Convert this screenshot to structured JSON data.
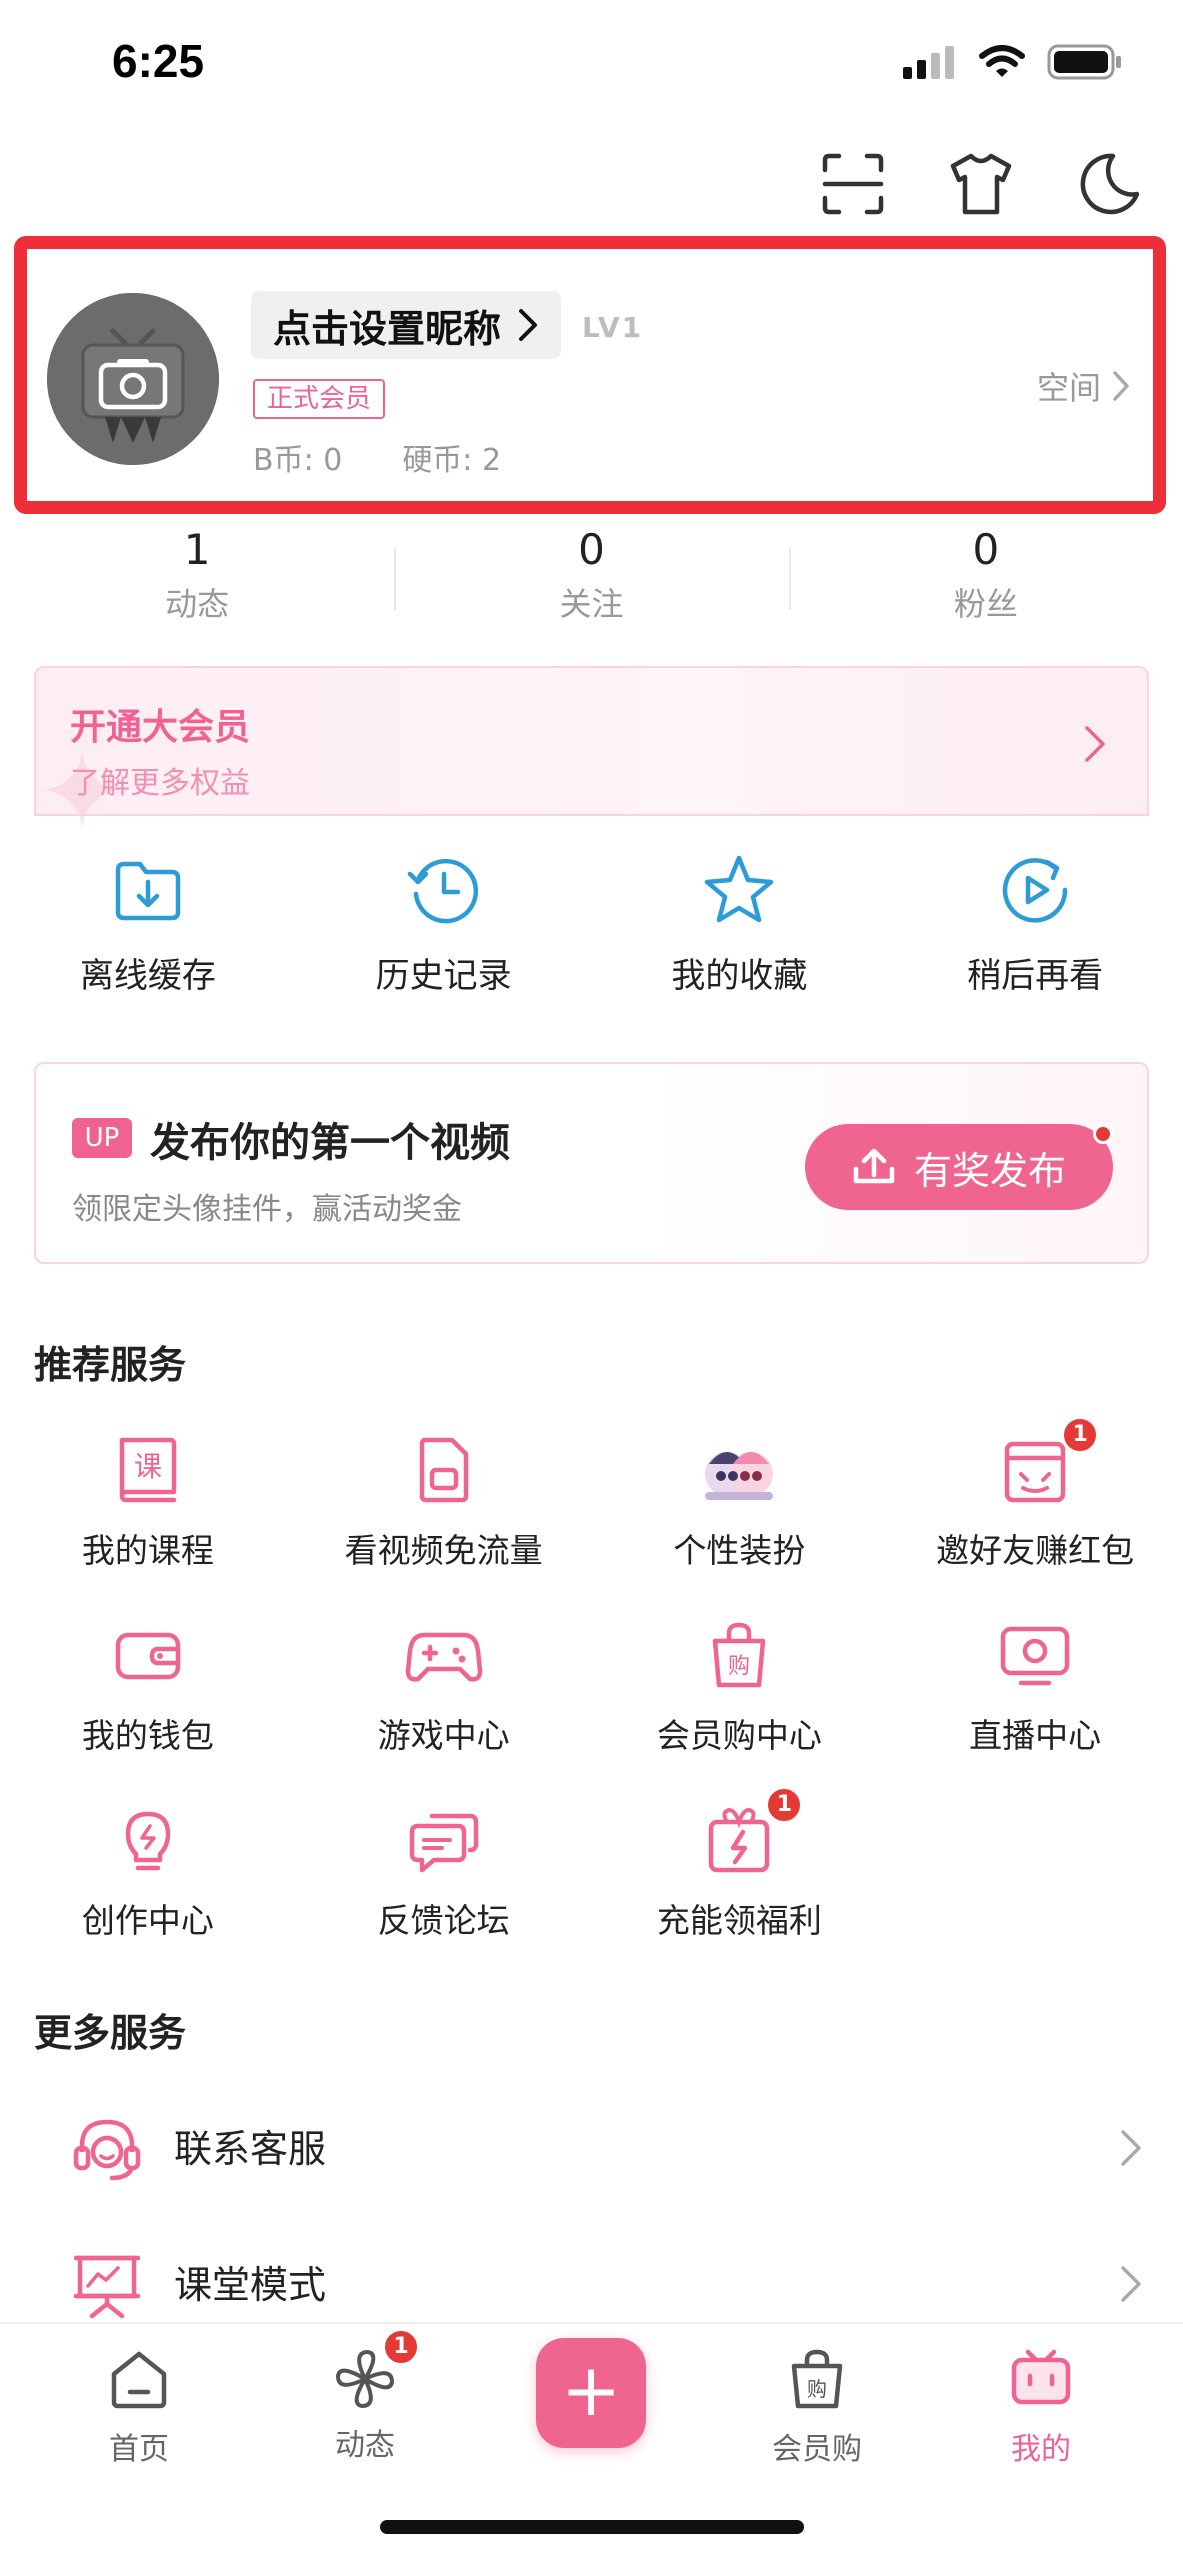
{
  "status_bar": {
    "time": "6:25"
  },
  "profile": {
    "nickname": "点击设置昵称",
    "level": "LV1",
    "vip_tag": "正式会员",
    "b_coins": "B币: 0",
    "coins": "硬币: 2",
    "space_label": "空间"
  },
  "stats": [
    {
      "value": "1",
      "label": "动态"
    },
    {
      "value": "0",
      "label": "关注"
    },
    {
      "value": "0",
      "label": "粉丝"
    }
  ],
  "vip_banner": {
    "title": "开通大会员",
    "subtitle": "了解更多权益"
  },
  "quick_actions": [
    {
      "label": "离线缓存",
      "icon": "download-folder-icon"
    },
    {
      "label": "历史记录",
      "icon": "history-clock-icon"
    },
    {
      "label": "我的收藏",
      "icon": "star-icon"
    },
    {
      "label": "稍后再看",
      "icon": "watch-later-icon"
    }
  ],
  "upload_card": {
    "badge": "UP",
    "title": "发布你的第一个视频",
    "subtitle": "领限定头像挂件，赢活动奖金",
    "button": "有奖发布"
  },
  "recommended": {
    "title": "推荐服务",
    "items": [
      {
        "label": "我的课程",
        "icon": "course-book-icon"
      },
      {
        "label": "看视频免流量",
        "icon": "sim-card-icon"
      },
      {
        "label": "个性装扮",
        "icon": "avatar-decoration-icon"
      },
      {
        "label": "邀好友赚红包",
        "icon": "invite-tv-icon",
        "badge": "1"
      },
      {
        "label": "我的钱包",
        "icon": "wallet-icon"
      },
      {
        "label": "游戏中心",
        "icon": "gamepad-icon"
      },
      {
        "label": "会员购中心",
        "icon": "shopping-bag-icon"
      },
      {
        "label": "直播中心",
        "icon": "live-tv-icon"
      },
      {
        "label": "创作中心",
        "icon": "lightbulb-icon"
      },
      {
        "label": "反馈论坛",
        "icon": "chat-bubbles-icon"
      },
      {
        "label": "充能领福利",
        "icon": "gift-bolt-icon",
        "badge": "1"
      }
    ]
  },
  "more_services": {
    "title": "更多服务",
    "items": [
      {
        "label": "联系客服",
        "icon": "headset-icon"
      },
      {
        "label": "课堂模式",
        "icon": "classroom-board-icon"
      }
    ]
  },
  "tab_bar": {
    "tabs": [
      {
        "label": "首页",
        "icon": "home-icon"
      },
      {
        "label": "动态",
        "icon": "pinwheel-icon",
        "badge": "1"
      },
      {
        "label": "+",
        "icon": "plus-icon"
      },
      {
        "label": "会员购",
        "icon": "shopping-bag-icon"
      },
      {
        "label": "我的",
        "icon": "tv-icon",
        "active": true
      }
    ]
  },
  "colors": {
    "accent": "#f06292",
    "highlight_border": "#ee2f3a",
    "badge": "#e53935"
  }
}
